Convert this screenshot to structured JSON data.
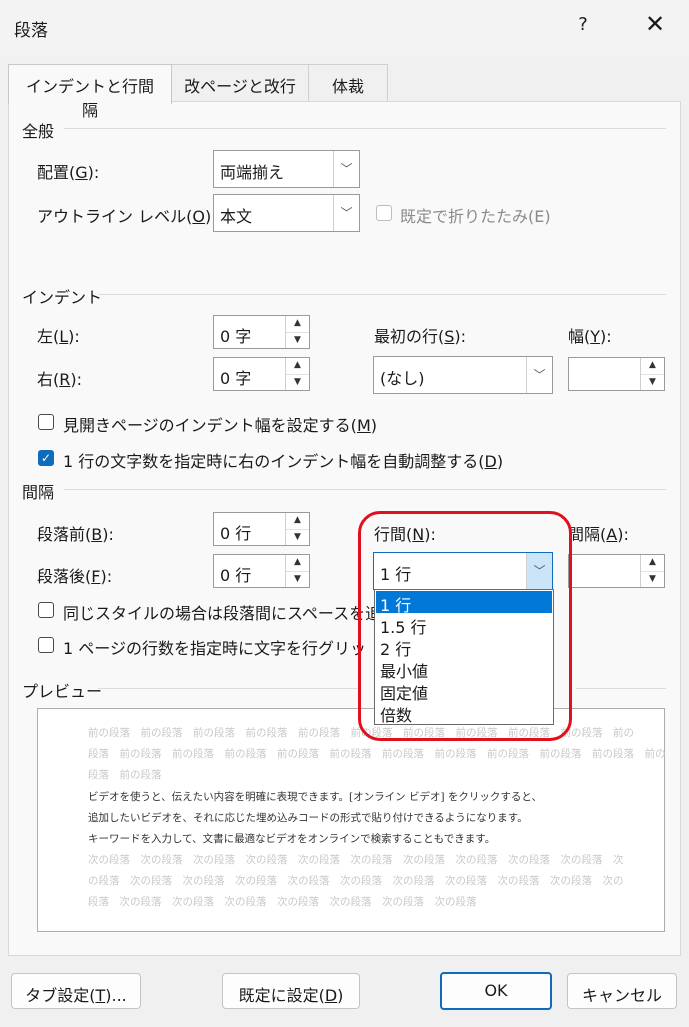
{
  "window": {
    "title": "段落",
    "help_label": "?",
    "close_label": "✕"
  },
  "tabs": [
    {
      "label": "インデントと行間隔"
    },
    {
      "label": "改ページと改行"
    },
    {
      "label": "体裁"
    }
  ],
  "general": {
    "heading": "全般",
    "alignment_label_pre": "配置(",
    "alignment_label_key": "G",
    "alignment_label_post": "):",
    "alignment_value": "両端揃え",
    "outline_label_pre": "アウトライン レベル(",
    "outline_label_key": "O",
    "outline_label_post": "):",
    "outline_value": "本文",
    "collapse_label": "既定で折りたたみ(E)"
  },
  "indent": {
    "heading": "インデント",
    "left_label_pre": "左(",
    "left_label_key": "L",
    "left_label_post": "):",
    "left_value": "0 字",
    "right_label_pre": "右(",
    "right_label_key": "R",
    "right_label_post": "):",
    "right_value": "0 字",
    "first_line_label_pre": "最初の行(",
    "first_line_label_key": "S",
    "first_line_label_post": "):",
    "first_line_value": "(なし)",
    "width_label_pre": "幅(",
    "width_label_key": "Y",
    "width_label_post": "):",
    "width_value": "",
    "mirror_label_pre": "見開きページのインデント幅を設定する(",
    "mirror_label_key": "M",
    "mirror_label_post": ")",
    "auto_adjust_label_pre": "1 行の文字数を指定時に右のインデント幅を自動調整する(",
    "auto_adjust_label_key": "D",
    "auto_adjust_label_post": ")",
    "check_mark": "✓"
  },
  "spacing": {
    "heading": "間隔",
    "before_label_pre": "段落前(",
    "before_label_key": "B",
    "before_label_post": "):",
    "before_value": "0 行",
    "after_label_pre": "段落後(",
    "after_label_key": "F",
    "after_label_post": "):",
    "after_value": "0 行",
    "line_spacing_label_pre": "行間(",
    "line_spacing_label_key": "N",
    "line_spacing_label_post": "):",
    "line_spacing_value": "1 行",
    "at_label_pre": "間隔(",
    "at_label_key": "A",
    "at_label_post": "):",
    "at_value": "",
    "line_spacing_options": [
      "1 行",
      "1.5 行",
      "2 行",
      "最小値",
      "固定値",
      "倍数"
    ],
    "selected_option": "1 行",
    "same_style_label_visible": "同じスタイルの場合は段落間にスペースを追",
    "grid_label_visible": "1 ページの行数を指定時に文字を行グリッ"
  },
  "preview": {
    "heading": "プレビュー",
    "prev_lines": [
      "前の段落　前の段落　前の段落　前の段落　前の段落　前の段落　前の段落　前の段落　前の段落　前の段落　前の",
      "段落　前の段落　前の段落　前の段落　前の段落　前の段落　前の段落　前の段落　前の段落　前の段落　前の段落　前の",
      "段落　前の段落"
    ],
    "body_lines": [
      "ビデオを使うと、伝えたい内容を明確に表現できます。[オンライン ビデオ] をクリックすると、",
      "追加したいビデオを、それに応じた埋め込みコードの形式で貼り付けできるようになります。",
      "キーワードを入力して、文書に最適なビデオをオンラインで検索することもできます。"
    ],
    "next_lines": [
      "次の段落　次の段落　次の段落　次の段落　次の段落　次の段落　次の段落　次の段落　次の段落　次の段落　次",
      "の段落　次の段落　次の段落　次の段落　次の段落　次の段落　次の段落　次の段落　次の段落　次の段落　次の",
      "段落　次の段落　次の段落　次の段落　次の段落　次の段落　次の段落　次の段落"
    ]
  },
  "buttons": {
    "tabs_pre": "タブ設定(",
    "tabs_key": "T",
    "tabs_post": ")...",
    "default_pre": "既定に設定(",
    "default_key": "D",
    "default_post": ")",
    "ok": "OK",
    "cancel": "キャンセル"
  },
  "colors": {
    "accent": "#0f6cbd",
    "selection": "#0078d7",
    "highlight": "#e0101e"
  }
}
